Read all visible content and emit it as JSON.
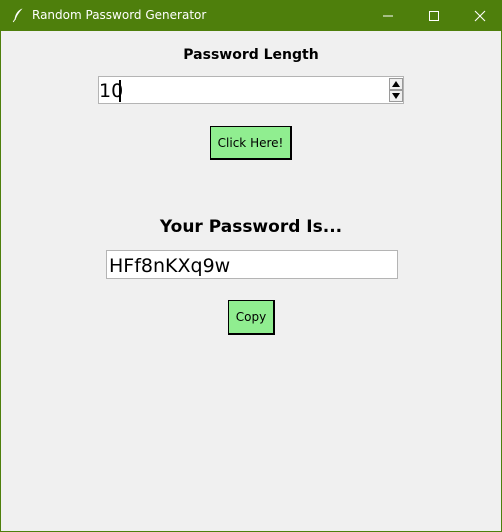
{
  "window": {
    "title": "Random Password Generator",
    "accent_color": "#4e7f0c",
    "app_icon": "feather-icon",
    "controls": [
      "minimize-icon",
      "maximize-icon",
      "close-icon"
    ]
  },
  "length_section": {
    "label": "Password Length",
    "value": "10"
  },
  "generate_button": {
    "label": "Click Here!",
    "color": "#90ee90"
  },
  "result_section": {
    "label": "Your Password Is...",
    "password": "HFf8nKXq9w"
  },
  "copy_button": {
    "label": "Copy",
    "color": "#90ee90"
  }
}
